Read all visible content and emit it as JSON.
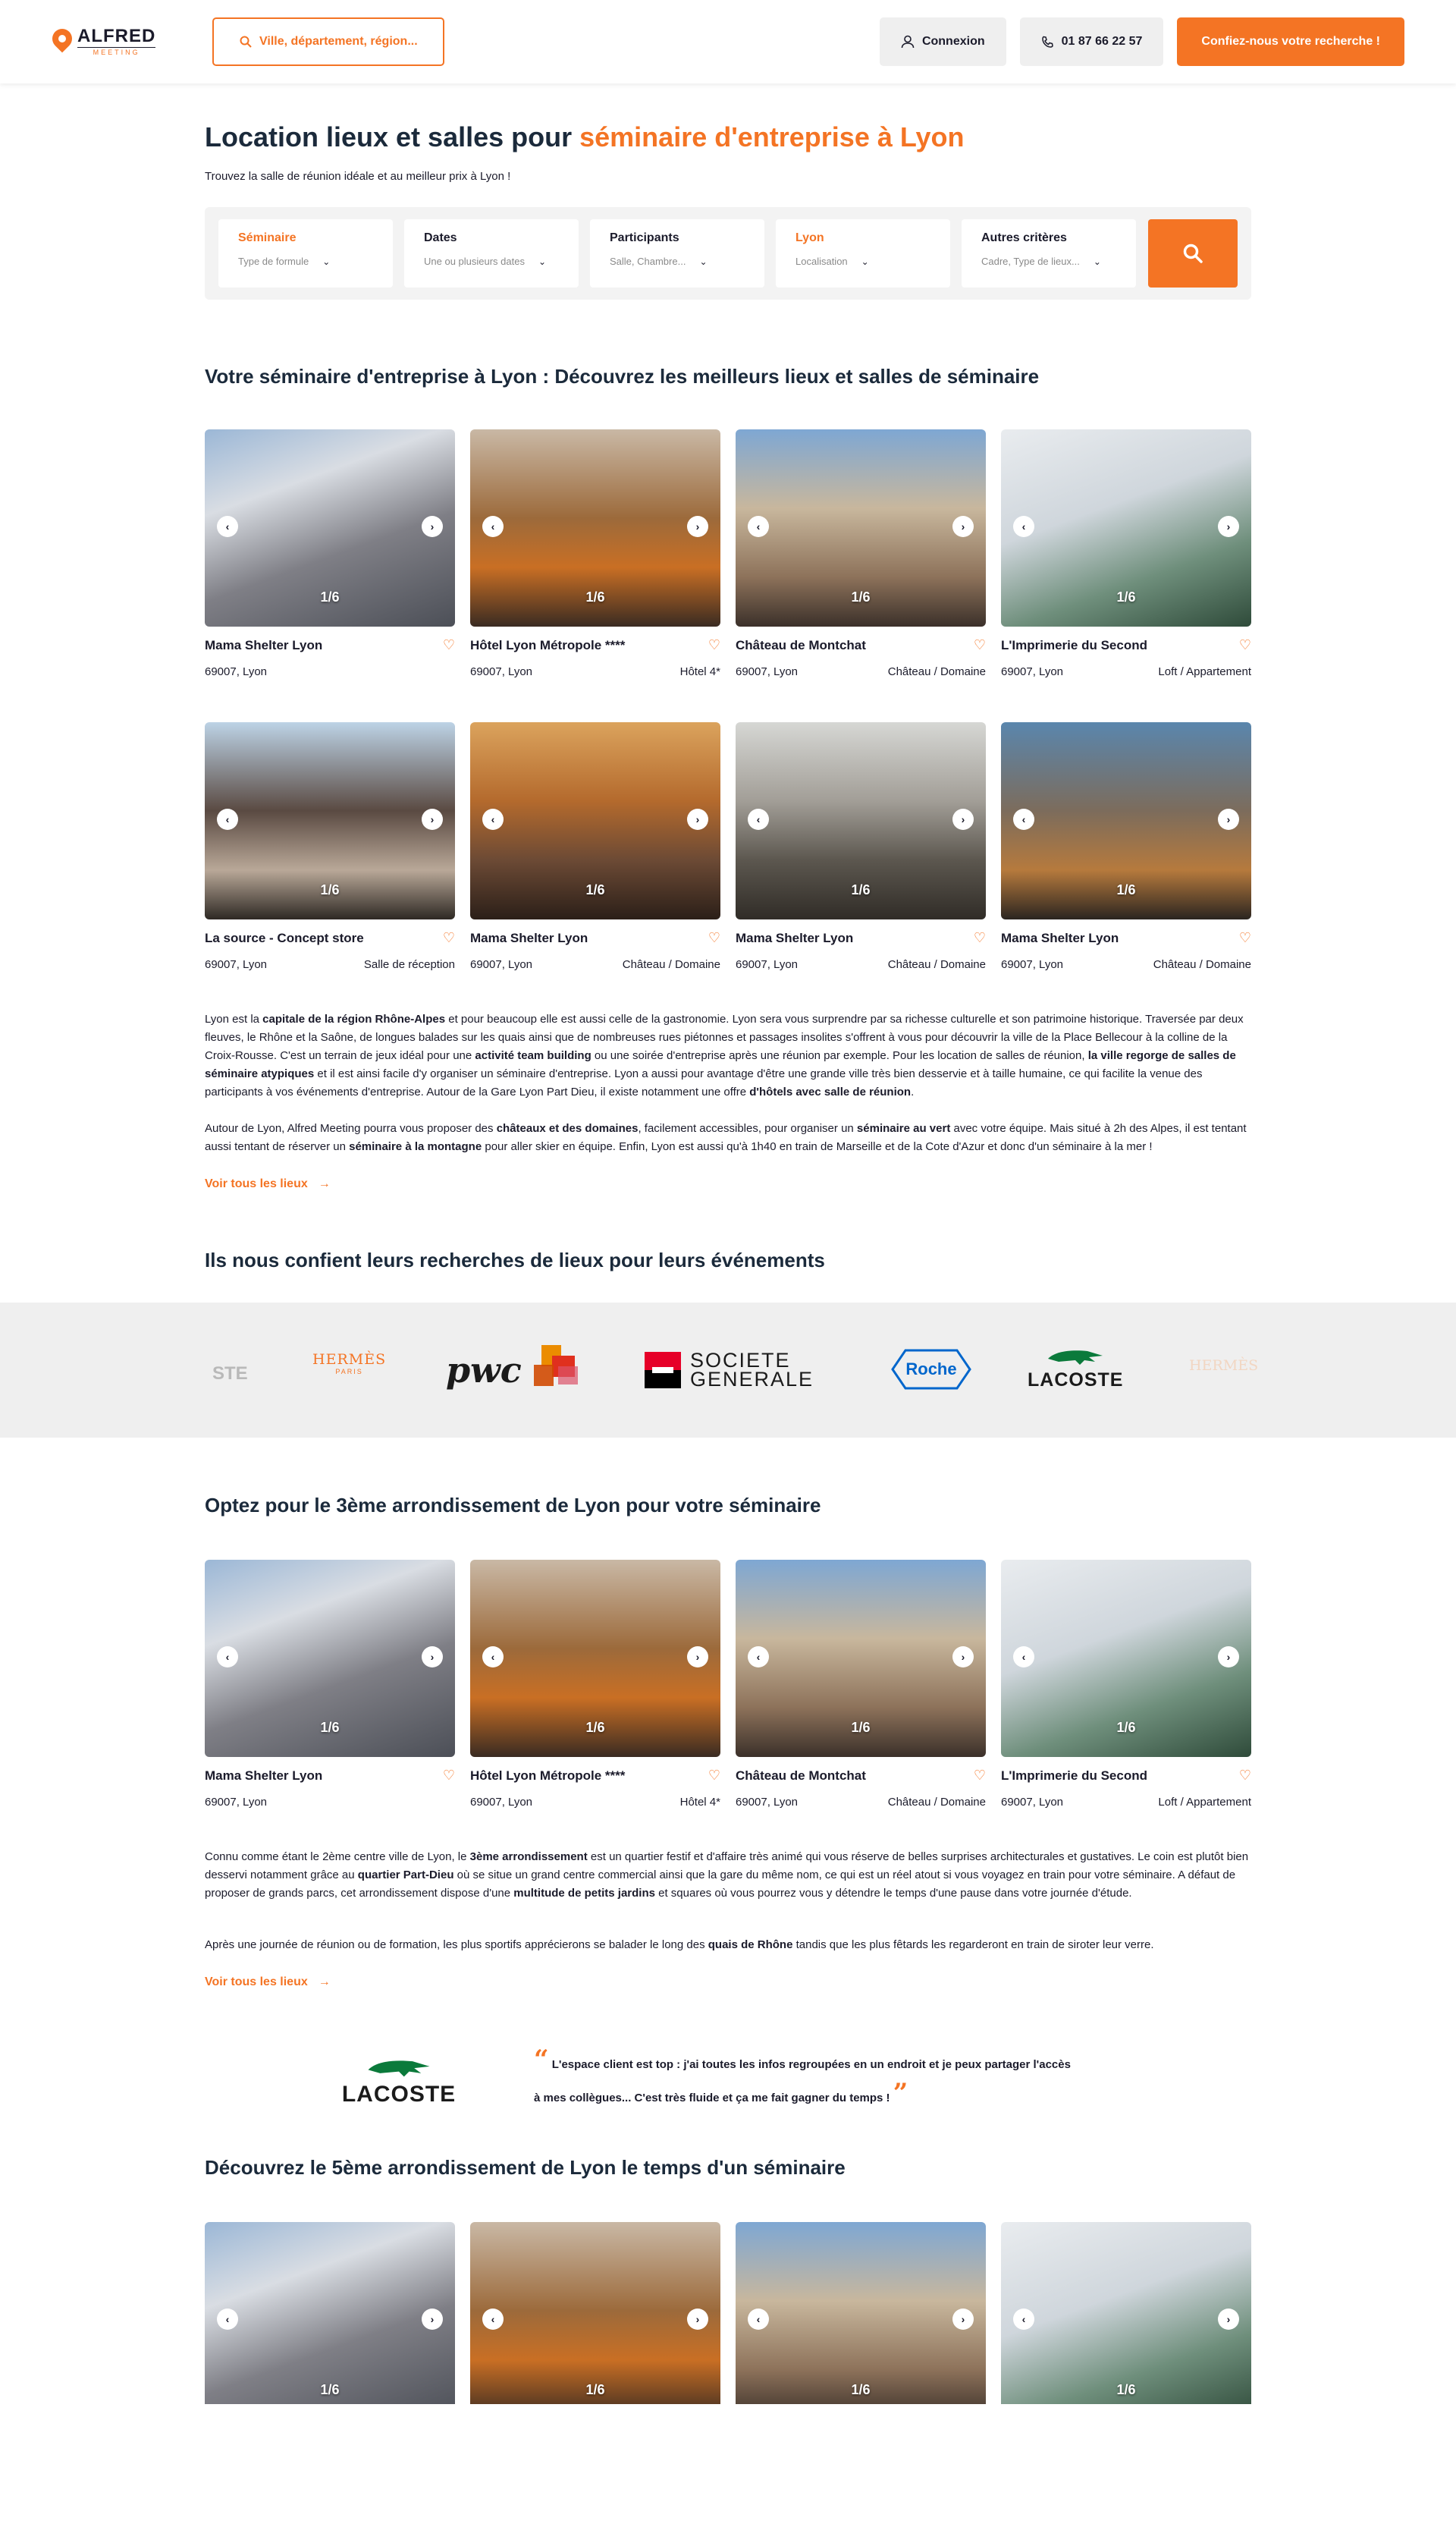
{
  "header": {
    "logo_main": "ALFRED",
    "logo_sub": "MEETING",
    "search_label": "Ville, département, région...",
    "login_label": "Connexion",
    "phone_label": "01 87 66 22 57",
    "cta_label": "Confiez-nous votre recherche !"
  },
  "hero": {
    "title_part1": "Location lieux et salles pour ",
    "title_part2": "séminaire d'entreprise à Lyon",
    "subtitle": "Trouvez la salle de réunion idéale et au meilleur prix à Lyon !"
  },
  "filters": [
    {
      "label": "Séminaire",
      "placeholder": "Type de formule",
      "active": true
    },
    {
      "label": "Dates",
      "placeholder": "Une ou plusieurs dates",
      "active": false
    },
    {
      "label": "Participants",
      "placeholder": "Salle, Chambre...",
      "active": false
    },
    {
      "label": "Lyon",
      "placeholder": "Localisation",
      "active": true
    },
    {
      "label": "Autres critères",
      "placeholder": "Cadre, Type de lieux...",
      "active": false
    }
  ],
  "section1": {
    "title": "Votre séminaire d'entreprise à Lyon : Découvrez les meilleurs lieux et salles de séminaire",
    "cards": [
      {
        "name": "Mama Shelter Lyon",
        "location": "69007, Lyon",
        "type": "",
        "counter": "1/6"
      },
      {
        "name": "Hôtel Lyon Métropole ****",
        "location": "69007, Lyon",
        "type": "Hôtel 4*",
        "counter": "1/6"
      },
      {
        "name": "Château de Montchat",
        "location": "69007, Lyon",
        "type": "Château / Domaine",
        "counter": "1/6"
      },
      {
        "name": "L'Imprimerie du Second",
        "location": "69007, Lyon",
        "type": "Loft / Appartement",
        "counter": "1/6"
      },
      {
        "name": "La source - Concept store",
        "location": "69007, Lyon",
        "type": "Salle de réception",
        "counter": "1/6"
      },
      {
        "name": "Mama Shelter Lyon",
        "location": "69007, Lyon",
        "type": "Château / Domaine",
        "counter": "1/6"
      },
      {
        "name": "Mama Shelter Lyon",
        "location": "69007, Lyon",
        "type": "Château / Domaine",
        "counter": "1/6"
      },
      {
        "name": "Mama Shelter Lyon",
        "location": "69007, Lyon",
        "type": "Château / Domaine",
        "counter": "1/6"
      }
    ],
    "p1": {
      "a": "Lyon est la ",
      "b": "capitale de la région Rhône-Alpes",
      "c": " et pour beaucoup elle est aussi celle de la gastronomie. Lyon sera vous surprendre par sa richesse culturelle et son patrimoine historique. Traversée par deux fleuves, le Rhône et la Saône, de longues balades sur les quais ainsi que de nombreuses rues piétonnes et passages insolites s'offrent à vous pour découvrir la ville de la Place Bellecour à la colline de la Croix-Rousse. C'est un terrain de jeux idéal pour une ",
      "d": "activité team building",
      "e": " ou une soirée d'entreprise après une réunion par exemple. Pour les location de salles de réunion, ",
      "f": "la ville regorge de salles de séminaire atypiques",
      "g": " et il est ainsi facile d'y organiser un séminaire d'entreprise. Lyon a aussi pour avantage d'être une grande ville très bien desservie et à taille humaine, ce qui facilite la venue des participants à vos événements d'entreprise. Autour de la Gare Lyon Part Dieu, il existe notamment une offre ",
      "h": "d'hôtels avec salle de réunion",
      "i": "."
    },
    "p2": {
      "a": "Autour de Lyon, Alfred Meeting pourra vous proposer des ",
      "b": "châteaux et des domaines",
      "c": ", facilement accessibles, pour organiser un ",
      "d": "séminaire au vert",
      "e": " avec votre équipe. Mais situé à 2h des Alpes, il est tentant aussi tentant de réserver un ",
      "f": "séminaire à la montagne",
      "g": " pour aller skier en équipe. Enfin, Lyon est aussi qu'à 1h40 en train de Marseille et de la Cote d'Azur et donc d'un séminaire à la mer !"
    },
    "see_all": "Voir tous les lieux"
  },
  "clients": {
    "title": "Ils nous confient leurs recherches de lieux pour leurs événements",
    "logos": [
      "STE",
      "HERMÈS",
      "PARIS",
      "pwc",
      "SOCIETE",
      "GENERALE",
      "Roche",
      "LACOSTE",
      "HERMÈS"
    ]
  },
  "section2": {
    "title": "Optez pour le 3ème arrondissement de Lyon pour votre séminaire",
    "cards": [
      {
        "name": "Mama Shelter Lyon",
        "location": "69007, Lyon",
        "type": "",
        "counter": "1/6"
      },
      {
        "name": "Hôtel Lyon Métropole ****",
        "location": "69007, Lyon",
        "type": "Hôtel 4*",
        "counter": "1/6"
      },
      {
        "name": "Château de Montchat",
        "location": "69007, Lyon",
        "type": "Château / Domaine",
        "counter": "1/6"
      },
      {
        "name": "L'Imprimerie du Second",
        "location": "69007, Lyon",
        "type": "Loft / Appartement",
        "counter": "1/6"
      }
    ],
    "p1": {
      "a": "Connu comme étant le 2ème centre ville de Lyon, le ",
      "b": "3ème arrondissement",
      "c": " est un quartier festif et d'affaire très animé qui vous réserve de belles surprises architecturales et gustatives. Le coin est plutôt bien desservi notamment grâce au ",
      "d": "quartier Part-Dieu",
      "e": " où se situe un grand centre commercial ainsi que la gare du même nom, ce qui est un réel atout si vous voyagez en train pour votre séminaire. A défaut de proposer de grands parcs, cet arrondissement dispose d'une ",
      "f": "multitude de petits jardins",
      "g": " et squares où vous pourrez vous y détendre le temps d'une pause dans votre journée d'étude."
    },
    "p2": {
      "a": "Après une journée de réunion ou de formation, les plus sportifs apprécierons se balader le long des ",
      "b": "quais de Rhône",
      "c": " tandis que les plus fêtards les regarderont en train de siroter leur verre."
    },
    "see_all": "Voir tous les lieux"
  },
  "testimonial": {
    "brand": "LACOSTE",
    "line1": "L'espace client est top : j'ai toutes les infos regroupées en un endroit et je peux partager l'accès",
    "line2": "à mes collègues... C'est très fluide et ça me fait gagner du temps !"
  },
  "section3": {
    "title": "Découvrez le 5ème arrondissement de Lyon le temps d'un séminaire",
    "counters": [
      "1/6",
      "1/6",
      "1/6",
      "1/6"
    ]
  },
  "colors": {
    "accent": "#f47424",
    "text": "#1b2a3b",
    "panel": "#efefef"
  }
}
